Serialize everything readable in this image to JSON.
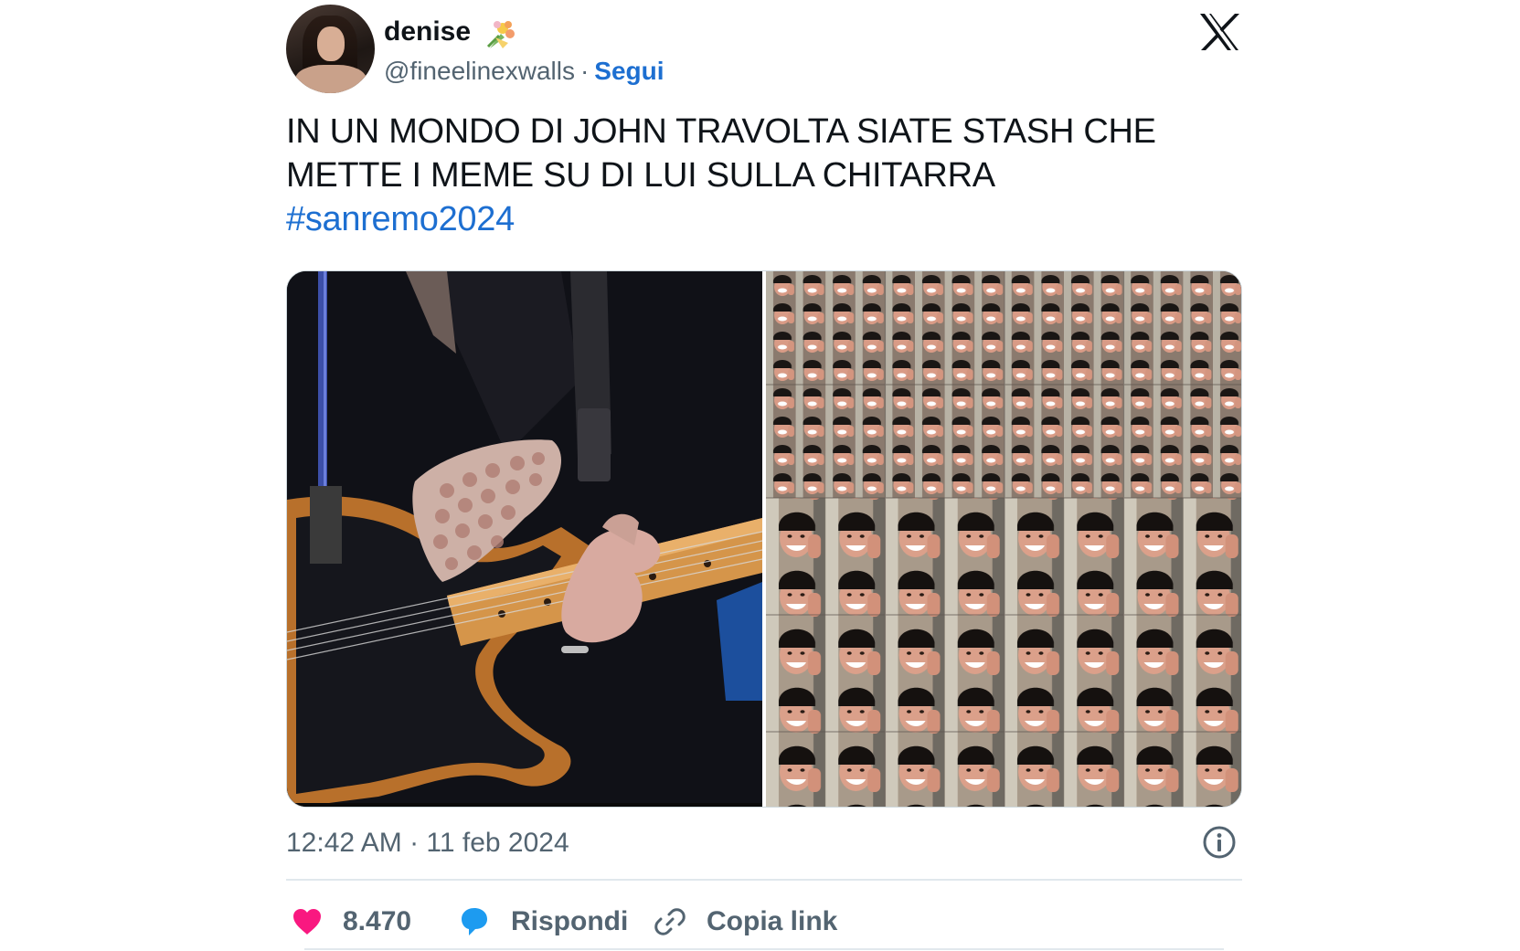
{
  "header": {
    "display_name": "denise",
    "emoji_icon": "bouquet-icon",
    "handle": "@fineelinexwalls",
    "separator": "·",
    "follow_label": "Segui",
    "logo_icon": "x-logo-icon"
  },
  "tweet": {
    "text": "IN UN MONDO DI JOHN TRAVOLTA SIATE STASH CHE METTE I MEME SU DI LUI SULLA CHITARRA",
    "hashtag": "#sanremo2024"
  },
  "media": {
    "left_image": "guitar-closeup-photo",
    "right_image": "meme-face-grid"
  },
  "footer": {
    "timestamp": "12:42 AM · 11 feb 2024",
    "info_icon": "info-icon"
  },
  "actions": {
    "like_count": "8.470",
    "reply_label": "Rispondi",
    "copy_label": "Copia link"
  },
  "colors": {
    "accent": "#1d6fd1",
    "like": "#f91880",
    "reply": "#1d9bf0",
    "muted": "#536471"
  }
}
